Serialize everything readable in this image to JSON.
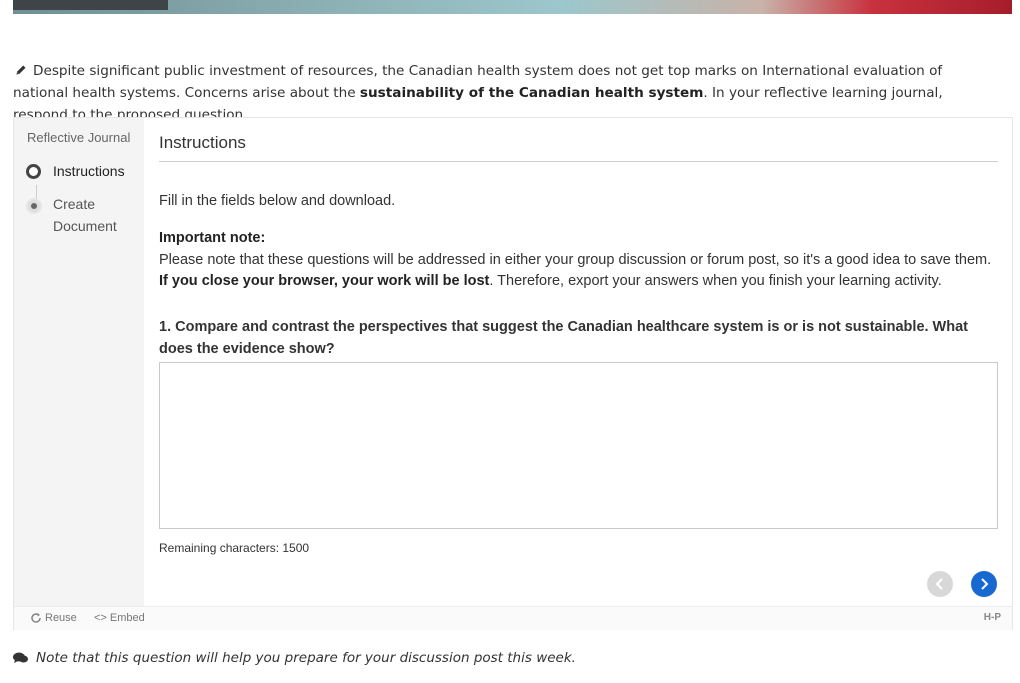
{
  "intro": {
    "text_part1": "Despite significant public investment of resources, the Canadian health system does not get top marks on International evaluation of national health systems. Concerns arise about the ",
    "bold": "sustainability of the Canadian health system",
    "text_part2": ". In your reflective learning journal, respond to the proposed question."
  },
  "sidebar": {
    "title": "Reflective Journal",
    "steps": [
      {
        "label": "Instructions",
        "state": "current"
      },
      {
        "label": "Create Document",
        "state": "upcoming"
      }
    ]
  },
  "main": {
    "title": "Instructions",
    "fill_text": "Fill in the fields below and download.",
    "important_label": "Important note:",
    "note_line": "Please note that these questions will be addressed in either your group discussion or forum post, so it's a good idea to save them.",
    "warning_bold": "If you close your browser, your work will be lost",
    "warning_rest": ". Therefore, export your answers when you finish your learning activity.",
    "question": "1. Compare and contrast the perspectives that suggest the Canadian healthcare system is or is not sustainable. What does the evidence show?",
    "answer_value": "",
    "remaining_label": "Remaining characters: 1500"
  },
  "footer": {
    "reuse": "Reuse",
    "embed": "Embed",
    "brand": "H-P"
  },
  "bottom_note": "Note that this question will help you prepare for your discussion post this week.",
  "colors": {
    "next_button": "#1768d0",
    "prev_button": "#d8d8d8",
    "sidebar_bg": "#f4f4f4"
  }
}
